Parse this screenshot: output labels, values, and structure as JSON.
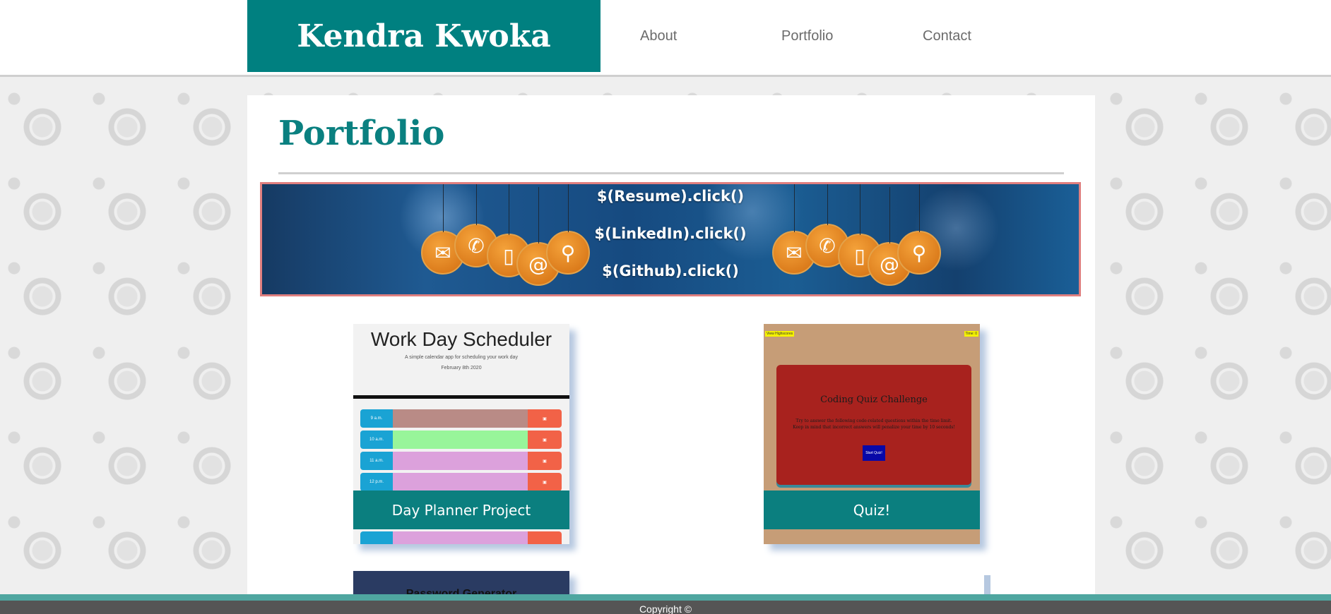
{
  "header": {
    "brand": "Kendra Kwoka",
    "nav": [
      "About",
      "Portfolio",
      "Contact"
    ]
  },
  "main": {
    "title": "Portfolio",
    "banner_links": [
      "$(Resume).click()",
      "$(LinkedIn).click()",
      "$(Github).click()"
    ],
    "projects": [
      {
        "caption": "Day Planner Project",
        "preview_title": "Work Day Scheduler",
        "preview_subtitle": "A simple calendar app for scheduling your work day",
        "preview_date": "February 8th 2020",
        "hours": [
          "9 a.m.",
          "10 a.m.",
          "11 a.m.",
          "12 p.m."
        ],
        "row_colors": [
          "#b98b86",
          "#98f59a",
          "#dca1dc",
          "#dca1dc"
        ]
      },
      {
        "caption": "Quiz!",
        "preview_title": "Coding Quiz Challenge",
        "preview_desc": "Try to answer the following code-related questions within the time limit. Keep in mind that incorrect answers will penalize your time by 10 seconds!",
        "preview_button": "Start Quiz!",
        "corner_left": "View Highscores",
        "corner_right": "Time: 0"
      },
      {
        "caption": "",
        "preview_title": "Password Generator"
      }
    ]
  },
  "footer": {
    "copyright": "Copyright ©"
  },
  "colors": {
    "teal": "#008080",
    "banner_border": "#e07f7f",
    "footer": "#555555"
  },
  "icons": [
    "mail-icon",
    "phone-icon",
    "mobile-icon",
    "at-icon",
    "location-icon"
  ]
}
